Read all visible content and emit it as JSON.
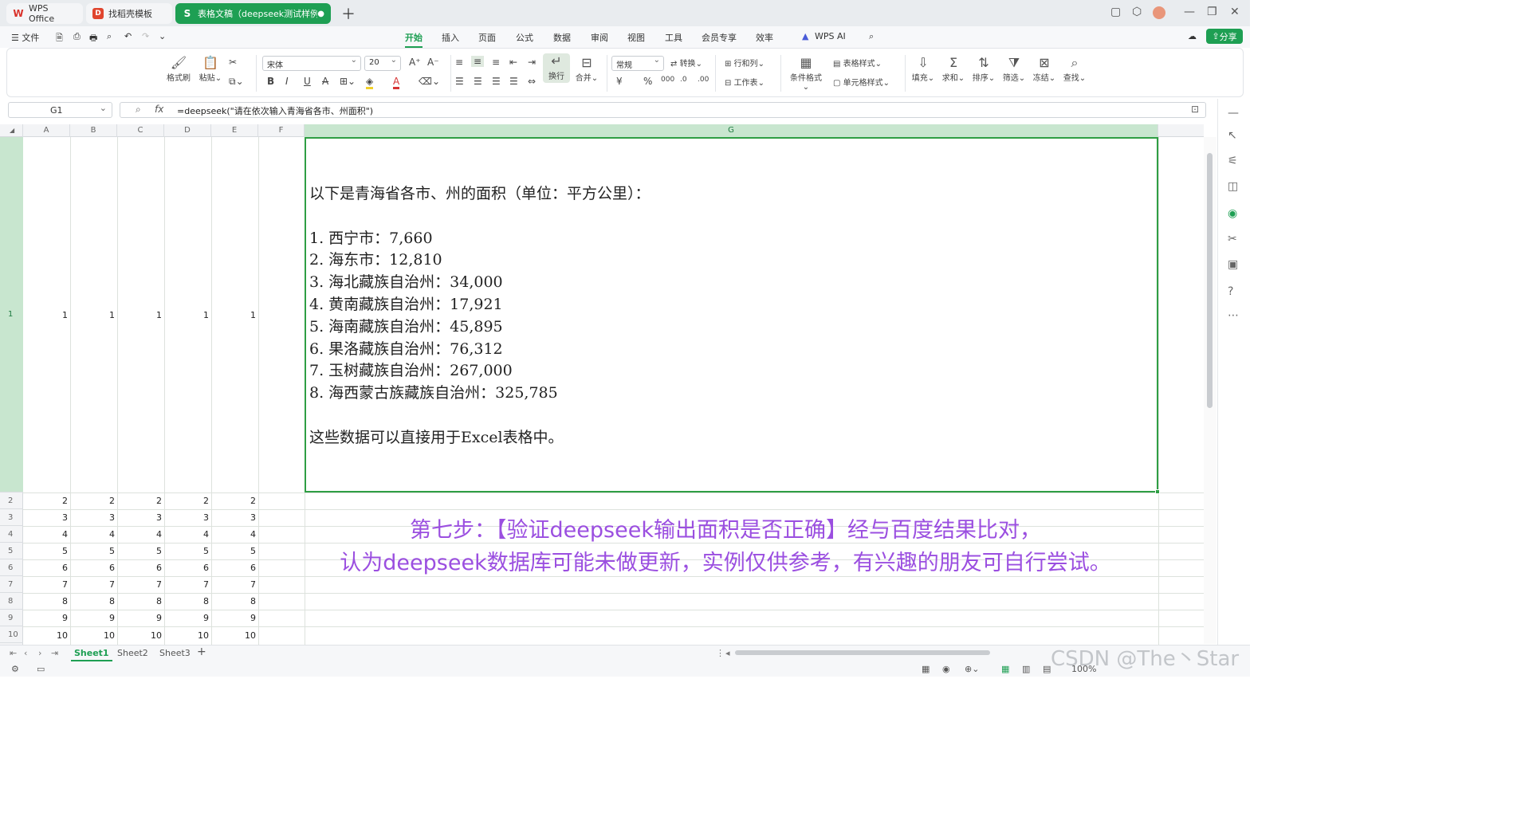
{
  "tabs": {
    "wps_office": "WPS Office",
    "template": "找稻壳模板",
    "document": "表格文稿（deepseek测试样例）.",
    "document_dot": "●"
  },
  "menu": {
    "file": "文件",
    "items": [
      "开始",
      "插入",
      "页面",
      "公式",
      "数据",
      "审阅",
      "视图",
      "工具",
      "会员专享",
      "效率"
    ],
    "wps_ai": "WPS AI",
    "share": "分享"
  },
  "ribbon": {
    "format_painter": "格式刷",
    "paste": "粘贴",
    "font_name": "宋体",
    "font_size": "20",
    "wrap": "换行",
    "merge": "合并",
    "number_format": "常规",
    "convert": "转换",
    "row_col": "行和列",
    "worksheet": "工作表",
    "cond_format": "条件格式",
    "table_style": "表格样式",
    "cell_style": "单元格样式",
    "fill": "填充",
    "sum": "求和",
    "sort": "排序",
    "filter": "筛选",
    "freeze": "冻结",
    "find": "查找",
    "currency": "¥",
    "percent": "%"
  },
  "formula_bar": {
    "cell_ref": "G1",
    "fx": "fx",
    "formula": "=deepseek(\"请在依次输入青海省各市、州面积\")"
  },
  "columns": [
    "A",
    "B",
    "C",
    "D",
    "E",
    "F",
    "G"
  ],
  "rows": [
    "1",
    "2",
    "3",
    "4",
    "5",
    "6",
    "7",
    "8",
    "9",
    "10"
  ],
  "g1_content": {
    "intro": "以下是青海省各市、州的面积（单位：平方公里）：",
    "items": [
      "1.  西宁市：7,660",
      "2.  海东市：12,810",
      "3.  海北藏族自治州：34,000",
      "4.  黄南藏族自治州：17,921",
      "5.  海南藏族自治州：45,895",
      "6.  果洛藏族自治州：76,312",
      "7.  玉树藏族自治州：267,000",
      "8.  海西蒙古族藏族自治州：325,785"
    ],
    "outro": "这些数据可以直接用于Excel表格中。"
  },
  "overlay": {
    "line1": "第七步：【验证deepseek输出面积是否正确】经与百度结果比对，",
    "line2": "认为deepseek数据库可能未做更新，实例仅供参考，有兴趣的朋友可自行尝试。"
  },
  "sheets": [
    "Sheet1",
    "Sheet2",
    "Sheet3"
  ],
  "status": {
    "zoom": "100%"
  },
  "watermark": "CSDN @The丶Star"
}
